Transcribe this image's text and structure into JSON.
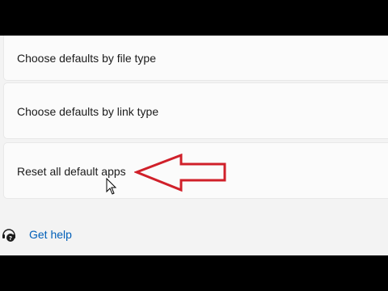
{
  "settings": {
    "items": [
      {
        "label": "Choose defaults by file type"
      },
      {
        "label": "Choose defaults by link type"
      },
      {
        "label": "Reset all default apps"
      }
    ]
  },
  "footer": {
    "help_link": "Get help",
    "help_icon": "help-headset-icon"
  },
  "annotation": {
    "arrow_color": "#d0202a",
    "arrow_icon": "left-arrow-outline-icon"
  },
  "colors": {
    "background": "#f3f3f3",
    "card": "#fbfbfb",
    "link": "#005fb8",
    "frame": "#000000"
  }
}
